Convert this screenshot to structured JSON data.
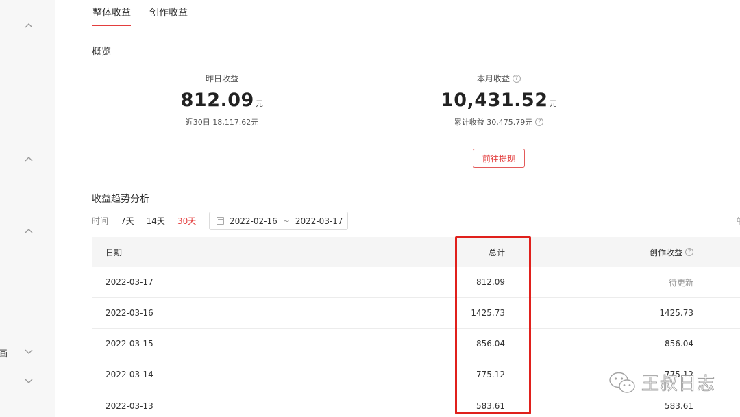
{
  "tabs": [
    {
      "label": "整体收益",
      "active": true
    },
    {
      "label": "创作收益",
      "active": false
    }
  ],
  "sidebar": {
    "partial_char": "画"
  },
  "overview": {
    "title": "概览",
    "yesterday": {
      "label": "昨日收益",
      "value": "812.09",
      "unit": "元",
      "sub": "近30日 18,117.62元"
    },
    "month": {
      "label": "本月收益",
      "value": "10,431.52",
      "unit": "元",
      "sub": "累计收益 30,475.79元"
    },
    "withdraw_button": "前往提现"
  },
  "trend": {
    "title": "收益趋势分析",
    "filter_label": "时间",
    "ranges": [
      {
        "label": "7天",
        "active": false
      },
      {
        "label": "14天",
        "active": false
      },
      {
        "label": "30天",
        "active": true
      }
    ],
    "date_start": "2022-02-16",
    "date_sep": "~",
    "date_end": "2022-03-17",
    "edge_char": "单"
  },
  "table": {
    "headers": {
      "date": "日期",
      "total": "总计",
      "creation": "创作收益"
    },
    "rows": [
      {
        "date": "2022-03-17",
        "total": "812.09",
        "creation": "待更新"
      },
      {
        "date": "2022-03-16",
        "total": "1425.73",
        "creation": "1425.73"
      },
      {
        "date": "2022-03-15",
        "total": "856.04",
        "creation": "856.04"
      },
      {
        "date": "2022-03-14",
        "total": "775.12",
        "creation": "775.12"
      },
      {
        "date": "2022-03-13",
        "total": "583.61",
        "creation": "583.61"
      }
    ]
  },
  "watermark": {
    "text": "王叔日志",
    "icon": "wechat-icon"
  },
  "colors": {
    "accent": "#e33e3e",
    "highlight": "#e0201c"
  }
}
